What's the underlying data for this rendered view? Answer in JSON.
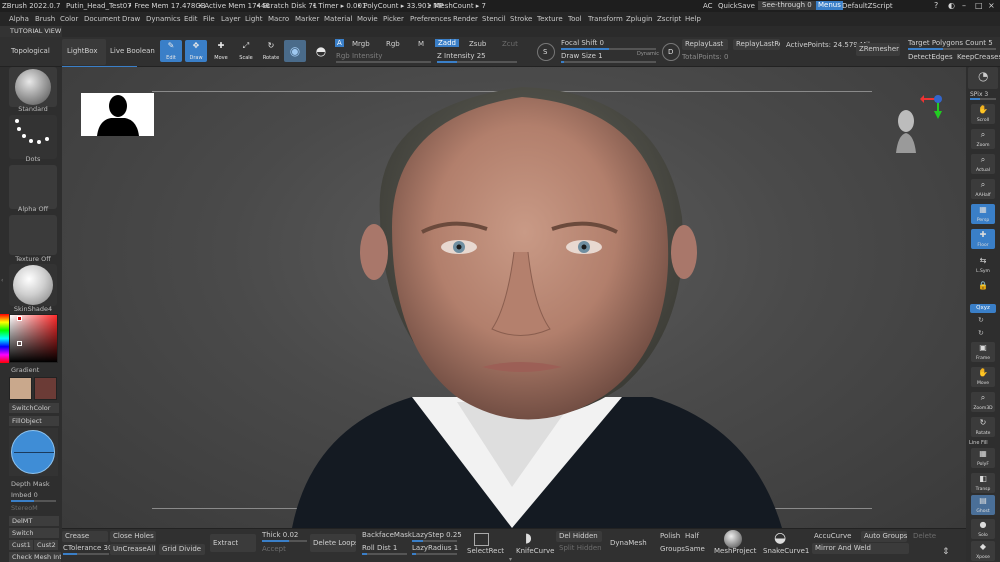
{
  "titlebar": {
    "app": "ZBrush 2022.0.7",
    "doc": "Putin_Head_Test07",
    "free_mem": "• Free Mem 17.478GB",
    "active_mem": "• Active Mem 17446",
    "scratch": "• Scratch Disk 71",
    "timer": "• Timer ▸ 0.001",
    "polycount": "• PolyCount ▸ 33.901 MP",
    "meshcount": "• MeshCount ▸ 7",
    "ac": "AC",
    "quicksave": "QuickSave",
    "seethrough": "See-through  0",
    "menus": "Menus",
    "zscript": "DefaultZScript"
  },
  "menubar": {
    "items": [
      "Alpha",
      "Brush",
      "Color",
      "Document",
      "Draw",
      "Dynamics",
      "Edit",
      "File",
      "Layer",
      "Light",
      "Macro",
      "Marker",
      "Material",
      "Movie",
      "Picker",
      "Preferences",
      "Render",
      "Stencil",
      "Stroke",
      "Texture",
      "Tool",
      "Transform",
      "Zplugin",
      "Zscript",
      "Help"
    ]
  },
  "tutorial": "TUTORIAL VIEW",
  "shelf": {
    "topological": "Topological",
    "lightbox": "LightBox",
    "live_boolean": "Live Boolean",
    "edit": "Edit",
    "draw": "Draw",
    "move": "Move",
    "scale": "Scale",
    "rotate": "Rotate",
    "a": "A",
    "mrgb": "Mrgb",
    "rgb": "Rgb",
    "m": "M",
    "zadd": "Zadd",
    "zsub": "Zsub",
    "zcut": "Zcut",
    "rgb_intensity": "Rgb Intensity",
    "z_intensity": "Z Intensity 25",
    "focal_shift": "Focal Shift 0",
    "draw_size": "Draw Size 1",
    "dynamic": "Dynamic",
    "replay_last": "ReplayLast",
    "replay_last_rel": "ReplayLastRel",
    "active_points": "ActivePoints: 24.579 Mil",
    "total_points": "TotalPoints: 0",
    "zremesher": "ZRemesher",
    "target_polygons": "Target Polygons Count 5",
    "detect_edges": "DetectEdges",
    "keep_creases": "KeepCreases",
    "s_badge": "S",
    "d_badge": "D"
  },
  "left": {
    "standard": "Standard",
    "dots": "Dots",
    "alpha_off": "Alpha Off",
    "texture_off": "Texture Off",
    "material": "SkinShade4",
    "gradient": "Gradient",
    "switch_color": "SwitchColor",
    "fill_object": "FillObject",
    "depth_mask": "Depth Mask",
    "imbed": "Imbed 0",
    "stereo_m": "StereoM",
    "del_mt": "DelMT",
    "switch": "Switch",
    "cust1": "Cust1",
    "cust2": "Cust2",
    "check_mesh": "Check Mesh Int",
    "main_color": "#c9a88c",
    "secondary_color": "#6b3b36"
  },
  "right": {
    "spix": "SPix 3",
    "scroll": "Scroll",
    "zoom": "Zoom",
    "actual": "Actual",
    "aahalf": "AAHalf",
    "persp": "Persp",
    "floor": "Floor",
    "lsym": "L.Sym",
    "lock": "",
    "qxyz": "Qxyz",
    "frame": "Frame",
    "move": "Move",
    "zoom3d": "Zoom3D",
    "rotate": "Rotate",
    "line_fill": "Line Fill",
    "polyf": "PolyF",
    "transp": "Transp",
    "ghost": "Ghost",
    "solo": "Solo",
    "xpose": "Xpose"
  },
  "bottom": {
    "crease": "Crease",
    "ctolerance": "CTolerance 30",
    "close_holes": "Close Holes",
    "uncrease_all": "UnCreaseAll",
    "grid_divide": "Grid Divide",
    "extract": "Extract",
    "thick": "Thick 0.02",
    "accept": "Accept",
    "delete_loops": "Delete Loops",
    "backface_mask": "BackfaceMask",
    "roll_dist": "Roll Dist 1",
    "lazy_step": "LazyStep 0.25",
    "lazy_radius": "LazyRadius 1",
    "select_rect": "SelectRect",
    "knife_curve": "KnifeCurve",
    "del_hidden": "Del Hidden",
    "split_hidden": "Split Hidden",
    "dyna_mesh": "DynaMesh",
    "polish": "Polish",
    "groups": "Groups",
    "half": "Half",
    "same": "Same",
    "mesh_project": "MeshProject",
    "snake_curve": "SnakeCurve1",
    "accu_curve": "AccuCurve",
    "mirror_weld": "Mirror And Weld",
    "auto_groups": "Auto Groups",
    "delete": "Delete"
  },
  "colors": {
    "accent": "#3a7fc8",
    "panel": "#303030",
    "canvas": "#4a4a4a"
  }
}
